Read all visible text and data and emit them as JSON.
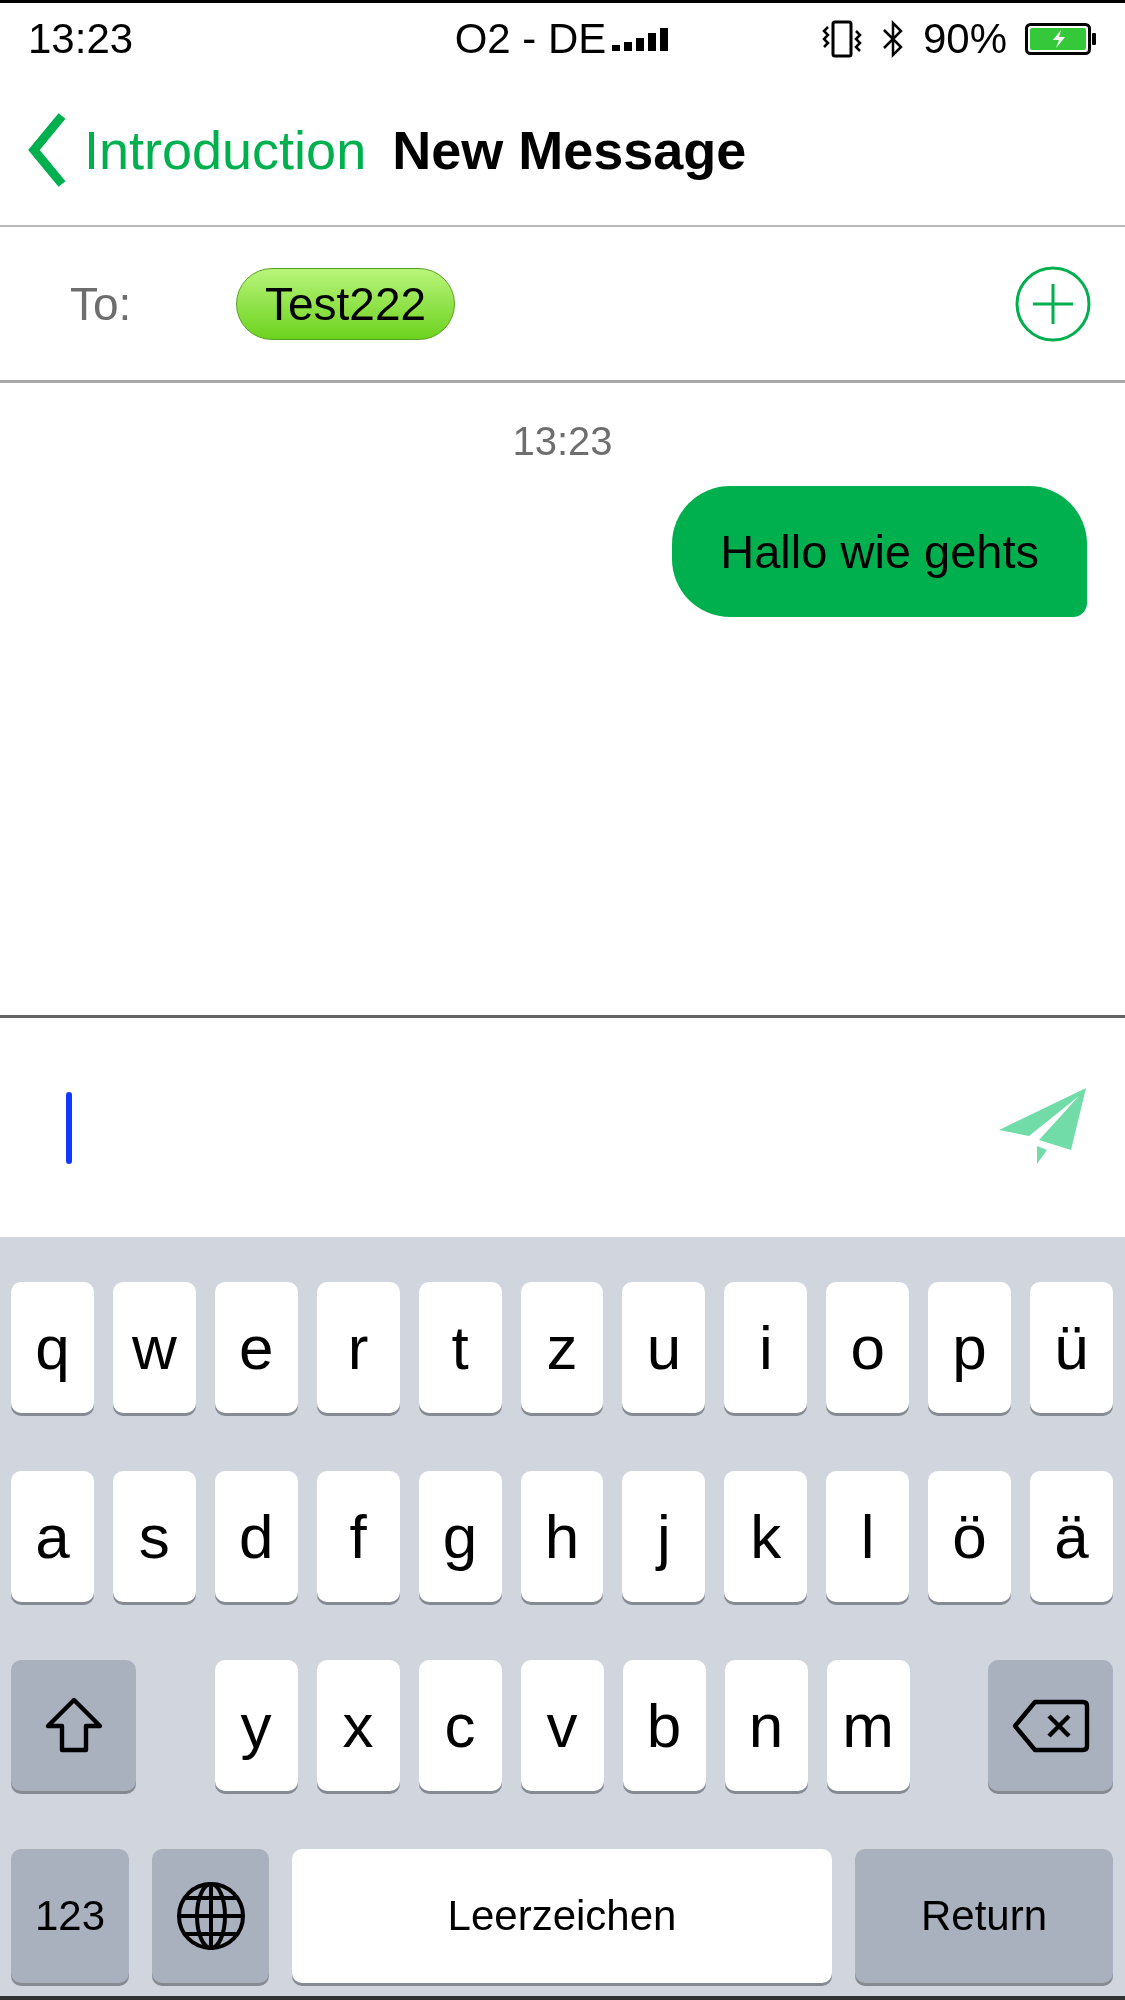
{
  "status_bar": {
    "time": "13:23",
    "carrier": "O2 - DE",
    "battery": "90%"
  },
  "nav": {
    "back_label": "Introduction",
    "title": "New Message"
  },
  "recipients": {
    "label": "To:",
    "tokens": [
      "Test222"
    ]
  },
  "conversation": {
    "timestamp": "13:23",
    "messages": [
      {
        "kind": "outgoing",
        "text": "Hallo wie gehts"
      }
    ]
  },
  "keyboard": {
    "rows": [
      {
        "keys": [
          {
            "kind": "letter",
            "label": "q"
          },
          {
            "kind": "letter",
            "label": "w"
          },
          {
            "kind": "letter",
            "label": "e"
          },
          {
            "kind": "letter",
            "label": "r"
          },
          {
            "kind": "letter",
            "label": "t"
          },
          {
            "kind": "letter",
            "label": "z"
          },
          {
            "kind": "letter",
            "label": "u"
          },
          {
            "kind": "letter",
            "label": "i"
          },
          {
            "kind": "letter",
            "label": "o"
          },
          {
            "kind": "letter",
            "label": "p"
          },
          {
            "kind": "letter",
            "label": "ü"
          }
        ]
      },
      {
        "keys": [
          {
            "kind": "letter",
            "label": "a"
          },
          {
            "kind": "letter",
            "label": "s"
          },
          {
            "kind": "letter",
            "label": "d"
          },
          {
            "kind": "letter",
            "label": "f"
          },
          {
            "kind": "letter",
            "label": "g"
          },
          {
            "kind": "letter",
            "label": "h"
          },
          {
            "kind": "letter",
            "label": "j"
          },
          {
            "kind": "letter",
            "label": "k"
          },
          {
            "kind": "letter",
            "label": "l"
          },
          {
            "kind": "letter",
            "label": "ö"
          },
          {
            "kind": "letter",
            "label": "ä"
          }
        ]
      },
      {
        "keys": [
          {
            "kind": "shift"
          },
          {
            "kind": "letter",
            "label": "y"
          },
          {
            "kind": "letter",
            "label": "x"
          },
          {
            "kind": "letter",
            "label": "c"
          },
          {
            "kind": "letter",
            "label": "v"
          },
          {
            "kind": "letter",
            "label": "b"
          },
          {
            "kind": "letter",
            "label": "n"
          },
          {
            "kind": "letter",
            "label": "m"
          },
          {
            "kind": "backspace"
          }
        ]
      },
      {
        "keys": [
          {
            "kind": "mode",
            "label": "123"
          },
          {
            "kind": "globe"
          },
          {
            "kind": "space",
            "label": "Leerzeichen"
          },
          {
            "kind": "return",
            "label": "Return"
          }
        ]
      }
    ]
  }
}
